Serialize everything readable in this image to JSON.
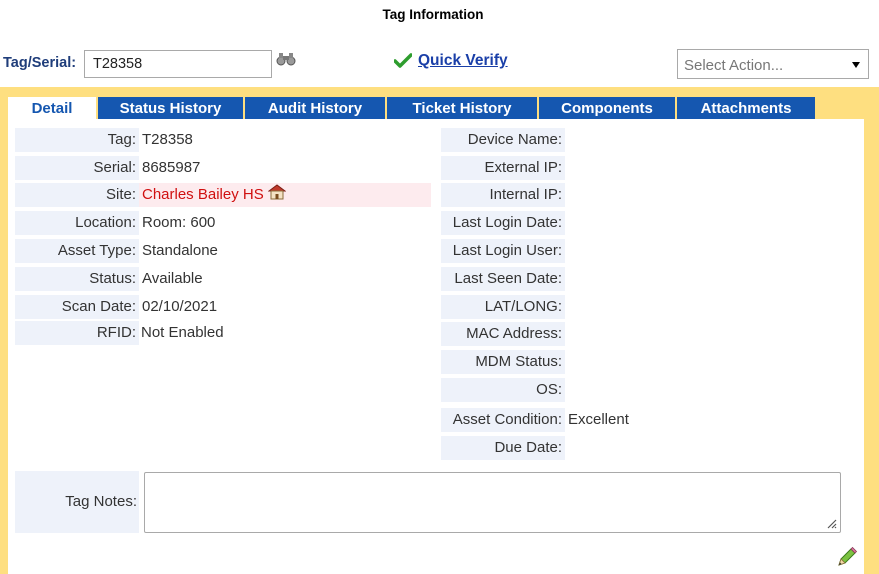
{
  "page": {
    "title": "Tag Information"
  },
  "header": {
    "tag_label": "Tag/Serial:",
    "tag_value": "T28358",
    "quick_verify": "Quick Verify",
    "select_action": "Select Action..."
  },
  "tabs": [
    {
      "label": "Detail",
      "active": true
    },
    {
      "label": "Status History"
    },
    {
      "label": "Audit History"
    },
    {
      "label": "Ticket History"
    },
    {
      "label": "Components"
    },
    {
      "label": "Attachments"
    }
  ],
  "left_fields": [
    {
      "label": "Tag:",
      "value": "T28358"
    },
    {
      "label": "Serial:",
      "value": "8685987"
    },
    {
      "label": "Site:",
      "value": "Charles Bailey HS"
    },
    {
      "label": "Location:",
      "value": "Room: 600"
    },
    {
      "label": "Asset Type:",
      "value": "Standalone"
    },
    {
      "label": "Status:",
      "value": "Available"
    },
    {
      "label": "Scan Date:",
      "value": "02/10/2021"
    },
    {
      "label": "RFID:",
      "value": "Not Enabled"
    }
  ],
  "right_fields": [
    {
      "label": "Device Name:",
      "value": ""
    },
    {
      "label": "External IP:",
      "value": ""
    },
    {
      "label": "Internal IP:",
      "value": ""
    },
    {
      "label": "Last Login Date:",
      "value": ""
    },
    {
      "label": "Last Login User:",
      "value": ""
    },
    {
      "label": "Last Seen Date:",
      "value": ""
    },
    {
      "label": "LAT/LONG:",
      "value": ""
    },
    {
      "label": "MAC Address:",
      "value": ""
    },
    {
      "label": "MDM Status:",
      "value": ""
    },
    {
      "label": "OS:",
      "value": ""
    },
    {
      "label": "Asset Condition:",
      "value": "Excellent"
    },
    {
      "label": "Due Date:",
      "value": ""
    }
  ],
  "notes": {
    "label": "Tag Notes:",
    "value": ""
  },
  "icons": {
    "search": "binoculars-icon",
    "verify": "checkmark-icon",
    "site": "house-icon",
    "edit": "pencil-icon"
  },
  "colors": {
    "tab_blue": "#1557b0",
    "frame_yellow": "#fedf80",
    "link_blue": "#1a3fa8",
    "site_red": "#d01010",
    "check_green": "#2e9d2e"
  }
}
